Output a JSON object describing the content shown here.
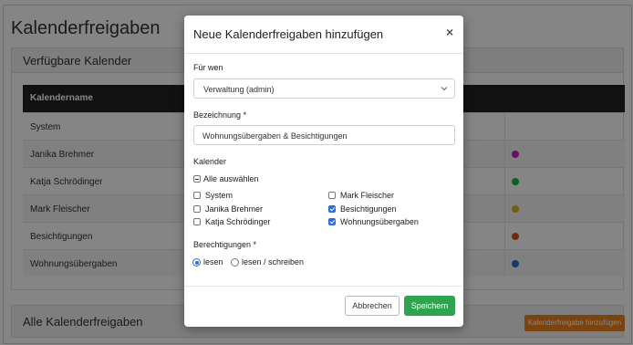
{
  "page": {
    "title": "Kalenderfreigaben",
    "panel_available_title": "Verfügbare Kalender",
    "table": {
      "header": "Kalendername",
      "rows": [
        {
          "name": "System",
          "color": ""
        },
        {
          "name": "Janika Brehmer",
          "color": "#c41ec4"
        },
        {
          "name": "Katja Schrödinger",
          "color": "#22b14c"
        },
        {
          "name": "Mark Fleischer",
          "color": "#d4b81a"
        },
        {
          "name": "Besichtigungen",
          "color": "#d4541a"
        },
        {
          "name": "Wohnungsübergaben",
          "color": "#2a6fdb"
        }
      ]
    },
    "panel_all_title": "Alle Kalenderfreigaben",
    "add_button": "Kalenderfreigabe hinzufügen",
    "add_button_color": "#e8821d"
  },
  "modal": {
    "title": "Neue Kalenderfreigaben hinzufügen",
    "close_label": "×",
    "for_whom_label": "Für wen",
    "for_whom_value": "Verwaltung (admin)",
    "designation_label": "Bezeichnung *",
    "designation_value": "Wohnungsübergaben & Besichtigungen",
    "calendar_label": "Kalender",
    "select_all_label": "Alle auswählen",
    "calendars": [
      {
        "label": "System",
        "checked": false
      },
      {
        "label": "Janika Brehmer",
        "checked": false
      },
      {
        "label": "Katja Schrödinger",
        "checked": false
      },
      {
        "label": "Mark Fleischer",
        "checked": false
      },
      {
        "label": "Besichtigungen",
        "checked": true
      },
      {
        "label": "Wohnungsübergaben",
        "checked": true
      }
    ],
    "permissions_label": "Berechtigungen *",
    "permissions": [
      {
        "label": "lesen",
        "selected": true
      },
      {
        "label": "lesen / schreiben",
        "selected": false
      }
    ],
    "cancel_label": "Abbrechen",
    "save_label": "Speichern",
    "save_color": "#2ea44f",
    "check_color": "#2a6fdb"
  }
}
